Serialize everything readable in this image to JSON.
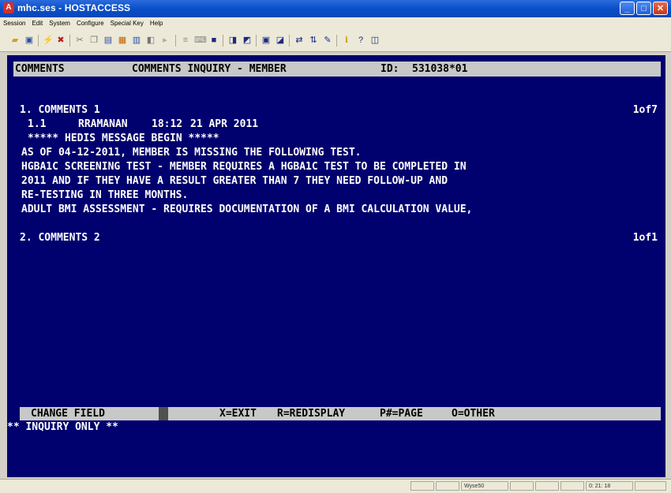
{
  "window": {
    "title": "mhc.ses - HOSTACCESS",
    "icon": "hostaccess-icon"
  },
  "menu": [
    "Session",
    "Edit",
    "System",
    "Configure",
    "Special Key",
    "Help"
  ],
  "toolbar": {
    "icons": [
      "open-icon",
      "save-icon",
      "connect-icon",
      "disconnect-icon",
      "cut-icon",
      "copy-icon",
      "paste-icon",
      "capture-icon",
      "print-icon",
      "record-icon",
      "play-icon",
      "macro-icon",
      "keyboard-icon",
      "zoom-icon",
      "settings-icon",
      "screen-icon",
      "font-icon",
      "color-icon",
      "transfer-icon",
      "sync-icon",
      "tools-icon",
      "info-icon",
      "help-icon",
      "display-icon"
    ]
  },
  "terminal": {
    "header": {
      "screen": "COMMENTS",
      "title": "COMMENTS INQUIRY - MEMBER",
      "id_label": "ID:",
      "id_value": "531038*01"
    },
    "sections": [
      {
        "heading": "1. COMMENTS 1",
        "pager": "1of7"
      },
      {
        "heading": "2. COMMENTS 2",
        "pager": "1of1"
      }
    ],
    "entry": {
      "number": "1.1",
      "user": "RRAMANAN",
      "time": "18:12",
      "date": "21 APR 2011"
    },
    "lines": [
      "***** HEDIS MESSAGE BEGIN *****",
      "AS OF 04-12-2011, MEMBER IS MISSING THE FOLLOWING TEST.",
      "HGBA1C SCREENING TEST - MEMBER REQUIRES A HGBA1C TEST TO BE COMPLETED IN",
      "2011 AND IF THEY HAVE A RESULT GREATER THAN 7 THEY NEED FOLLOW-UP AND",
      "RE-TESTING IN THREE MONTHS.",
      "ADULT BMI ASSESSMENT - REQUIRES DOCUMENTATION OF A BMI CALCULATION VALUE,"
    ],
    "fkeys": {
      "change": "CHANGE FIELD",
      "exit": "X=EXIT",
      "redisplay": "R=REDISPLAY",
      "page": "P#=PAGE",
      "other": "O=OTHER"
    },
    "status": "** INQUIRY ONLY **"
  },
  "statusbar": {
    "emulation": "Wyse50",
    "cursor": "0: 21: 18"
  }
}
